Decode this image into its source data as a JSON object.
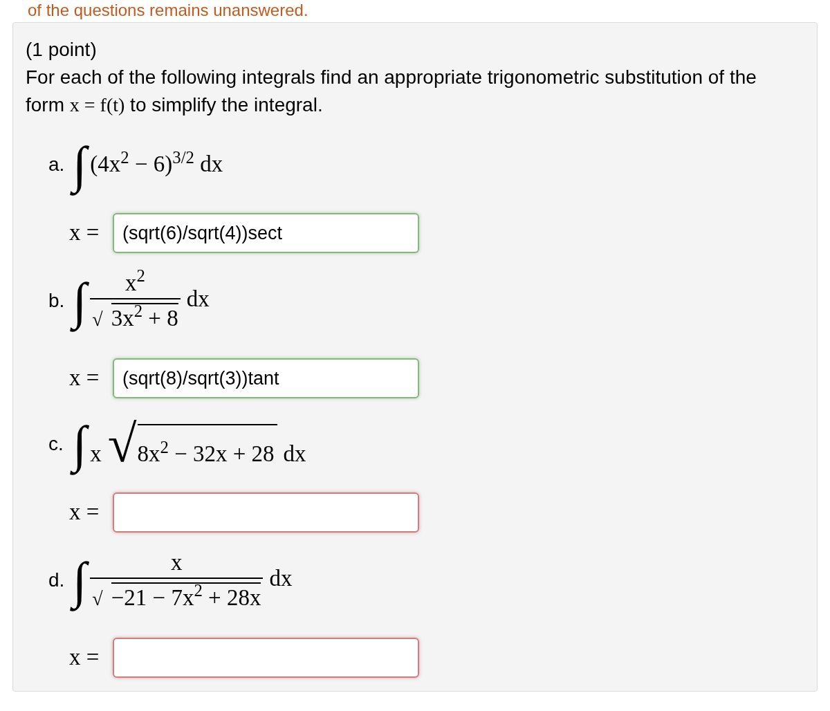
{
  "status_message": "of the questions remains unanswered.",
  "problem": {
    "points": "(1 point)",
    "instructions": [
      {
        "kind": "text",
        "text": "For each of the following integrals find an appropriate trigonometric substitution of the form"
      },
      {
        "kind": "math",
        "text": "x = f(t)"
      },
      {
        "kind": "text",
        "text": "to simplify the integral."
      }
    ]
  },
  "integrals": [
    {
      "label": "a.",
      "integral_sign": "∫",
      "integrand": [
        {
          "kind": "text",
          "text": "(4x$^{2}$ − 6)$^{3/2}$ dx"
        }
      ],
      "answer": {
        "variable_label": "x =",
        "value": "(sqrt(6)/sqrt(4))sect",
        "correct": true
      }
    },
    {
      "label": "b.",
      "integral_sign": "∫",
      "integrand": [
        {
          "kind": "frac",
          "numerator": [
            {
              "kind": "text",
              "text": "x$^{2}$"
            }
          ],
          "denominator": [
            {
              "kind": "sqrt",
              "sign": "√",
              "radicand": [
                {
                  "kind": "text",
                  "text": "3x$^{2}$ + 8"
                }
              ]
            }
          ]
        },
        {
          "kind": "text",
          "text": "dx"
        }
      ],
      "answer": {
        "variable_label": "x =",
        "value": "(sqrt(8)/sqrt(3))tant",
        "correct": true
      }
    },
    {
      "label": "c.",
      "integral_sign": "∫",
      "integrand": [
        {
          "kind": "text",
          "text": "x"
        },
        {
          "kind": "sqrt",
          "sign": "√",
          "radicand": [
            {
              "kind": "text",
              "text": "8x$^{2}$ − 32x + 28"
            }
          ]
        },
        {
          "kind": "text",
          "text": "dx"
        }
      ],
      "answer": {
        "variable_label": "x =",
        "correct": false
      }
    },
    {
      "label": "d.",
      "integral_sign": "∫",
      "integrand": [
        {
          "kind": "frac",
          "numerator": [
            {
              "kind": "text",
              "text": "x"
            }
          ],
          "denominator": [
            {
              "kind": "sqrt",
              "sign": "√",
              "radicand": [
                {
                  "kind": "text",
                  "text": "−21 − 7x$^{2}$ + 28x"
                }
              ]
            }
          ]
        },
        {
          "kind": "text",
          "text": "dx"
        }
      ],
      "answer": {
        "variable_label": "x =",
        "correct": false
      }
    }
  ]
}
